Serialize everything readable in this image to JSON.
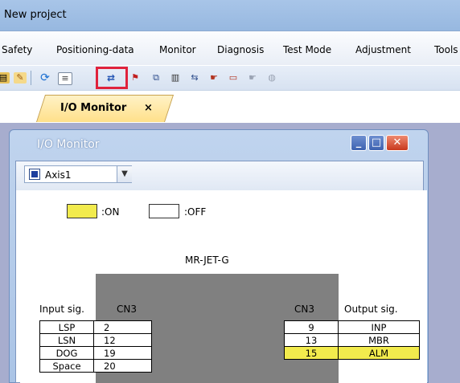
{
  "window": {
    "title": "New project"
  },
  "menu": [
    "Safety",
    "Positioning-data",
    "Monitor",
    "Diagnosis",
    "Test Mode",
    "Adjustment",
    "Tools"
  ],
  "toolbar_icons": [
    "read-icon",
    "write-icon",
    "refresh-icon",
    "parameter-list-icon",
    "io-monitor-icon",
    "alarm-display-icon",
    "axis-monitor-icon",
    "drive-recorder-icon",
    "jog-icon",
    "positioning-icon",
    "motorless-icon",
    "program-icon",
    "machine-analyzer-icon"
  ],
  "tab": {
    "label": "I/O Monitor",
    "close": "×"
  },
  "child_window": {
    "title": "I/O Monitor",
    "minimize": "_",
    "maximize": "□",
    "close": "✕"
  },
  "axis_selector": {
    "value": "Axis1"
  },
  "legend": {
    "on_label": ":ON",
    "off_label": ":OFF",
    "on_color": "#f2eb4d",
    "off_color": "#ffffff"
  },
  "model": "MR-JET-G",
  "input": {
    "header": "Input sig.",
    "connector": "CN3",
    "rows": [
      {
        "signal": "LSP",
        "pin": "2",
        "on": false
      },
      {
        "signal": "LSN",
        "pin": "12",
        "on": false
      },
      {
        "signal": "DOG",
        "pin": "19",
        "on": false
      },
      {
        "signal": "Space",
        "pin": "20",
        "on": false
      }
    ]
  },
  "output": {
    "header": "Output sig.",
    "connector": "CN3",
    "rows": [
      {
        "pin": "9",
        "signal": "INP",
        "on": false
      },
      {
        "pin": "13",
        "signal": "MBR",
        "on": false
      },
      {
        "pin": "15",
        "signal": "ALM",
        "on": true
      }
    ]
  }
}
